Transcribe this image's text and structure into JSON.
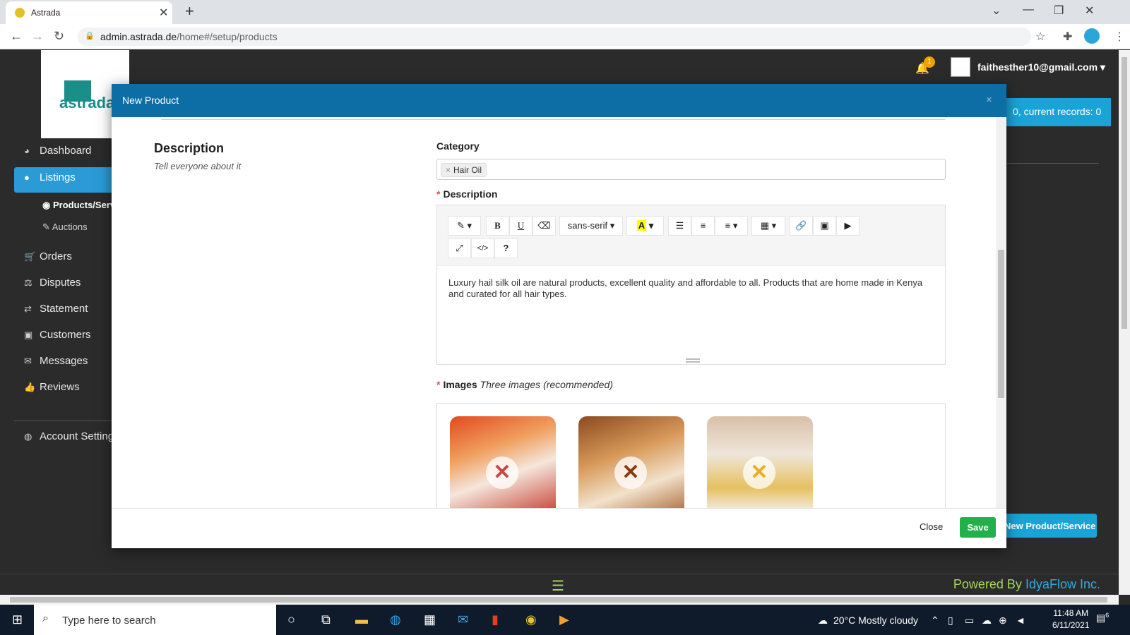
{
  "browser": {
    "tab_title": "Astrada",
    "tab_close": "✕",
    "new_tab": "+",
    "url_domain": "admin.astrada.de",
    "url_path": "/home#/setup/products"
  },
  "app": {
    "logo_text": "astrada",
    "notification_count": "1",
    "user_email": "faithesther10@gmail.com",
    "records_text": "0, current records: 0",
    "new_product_button": "New Product/Service"
  },
  "sidebar": {
    "items": [
      {
        "label": "Dashboard",
        "icon": "dashboard-icon"
      },
      {
        "label": "Listings",
        "icon": "listings-icon"
      },
      {
        "label": "Orders",
        "icon": "cart-icon"
      },
      {
        "label": "Disputes",
        "icon": "balance-icon"
      },
      {
        "label": "Statement",
        "icon": "exchange-icon"
      },
      {
        "label": "Customers",
        "icon": "address-book-icon"
      },
      {
        "label": "Messages",
        "icon": "chat-icon"
      },
      {
        "label": "Reviews",
        "icon": "thumbs-up-icon"
      },
      {
        "label": "Account Settings",
        "icon": "user-circle-icon"
      }
    ],
    "subitems": [
      {
        "label": "Products/Services"
      },
      {
        "label": "Auctions"
      }
    ]
  },
  "modal": {
    "title": "New Product",
    "close_x": "×",
    "section_title": "Description",
    "section_subtitle": "Tell everyone about it",
    "category_label": "Category",
    "category_tag": "Hair Oil",
    "description_label": "Description",
    "required_mark": "*",
    "font_name": "sans-serif",
    "description_text": "Luxury hail silk oil are natural products, excellent quality and affordable to all. Products that are home made in Kenya and curated for all hair types.",
    "images_label": "Images",
    "images_hint": "Three images (recommended)",
    "close_button": "Close",
    "save_button": "Save"
  },
  "footer": {
    "powered_by": "Powered By",
    "brand": "IdyaFlow Inc."
  },
  "taskbar": {
    "search_placeholder": "Type here to search",
    "weather": "20°C  Mostly cloudy",
    "time": "11:48 AM",
    "date": "6/11/2021",
    "notifications": "6"
  },
  "colors": {
    "modal_header": "#0d6ea6",
    "accent_blue": "#1aa3d6",
    "save_green": "#22b04b",
    "footer_green": "#a4d65e"
  }
}
